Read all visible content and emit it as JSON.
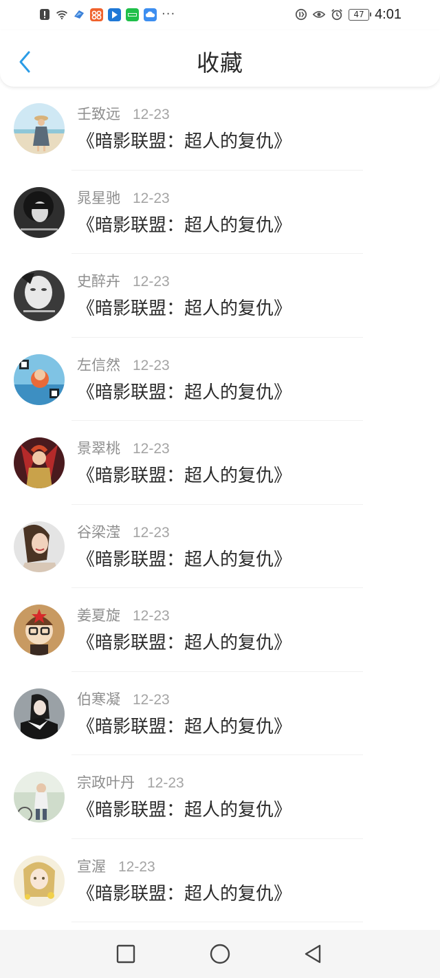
{
  "status_bar": {
    "left_icons": [
      "alert-icon",
      "wifi-icon",
      "app-icon-blue-bird",
      "app-icon-orange",
      "app-icon-blue-arrow",
      "app-icon-iqiyi",
      "app-icon-cloud"
    ],
    "more": "···",
    "battery": "47",
    "time": "4:01"
  },
  "header": {
    "title": "收藏",
    "back_icon": "chevron-left-icon"
  },
  "favorites": [
    {
      "name": "壬致远",
      "date": "12-23",
      "movie": "《暗影联盟：超人的复仇》"
    },
    {
      "name": "晁星驰",
      "date": "12-23",
      "movie": "《暗影联盟：超人的复仇》"
    },
    {
      "name": "史醉卉",
      "date": "12-23",
      "movie": "《暗影联盟：超人的复仇》"
    },
    {
      "name": "左信然",
      "date": "12-23",
      "movie": "《暗影联盟：超人的复仇》"
    },
    {
      "name": "景翠桃",
      "date": "12-23",
      "movie": "《暗影联盟：超人的复仇》"
    },
    {
      "name": "谷梁滢",
      "date": "12-23",
      "movie": "《暗影联盟：超人的复仇》"
    },
    {
      "name": "姜夏旋",
      "date": "12-23",
      "movie": "《暗影联盟：超人的复仇》"
    },
    {
      "name": "伯寒凝",
      "date": "12-23",
      "movie": "《暗影联盟：超人的复仇》"
    },
    {
      "name": "宗政叶丹",
      "date": "12-23",
      "movie": "《暗影联盟：超人的复仇》"
    },
    {
      "name": "宣渥",
      "date": "12-23",
      "movie": "《暗影联盟：超人的复仇》"
    }
  ],
  "system_nav": {
    "recents_icon": "square-icon",
    "home_icon": "circle-icon",
    "back_icon": "triangle-back-icon"
  },
  "colors": {
    "accent": "#2b9ce6",
    "name_text": "#8e8e8e",
    "title_text": "#2a2a2a",
    "nav_bar_bg": "#f5f5f5"
  }
}
